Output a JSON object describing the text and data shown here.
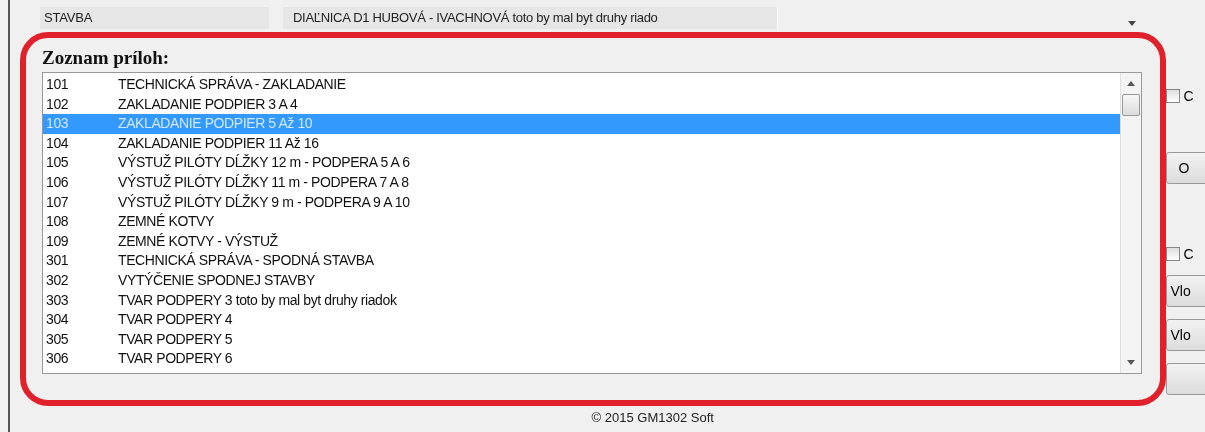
{
  "header": {
    "label": "STAVBA",
    "value": "DIAĽNICA D1 HUBOVÁ - IVACHNOVÁ toto by mal byt druhy riado"
  },
  "attachments": {
    "title": "Zoznam príloh:",
    "rows": [
      {
        "number": "101",
        "name": "TECHNICKÁ SPRÁVA - ZAKLADANIE",
        "selected": false
      },
      {
        "number": "102",
        "name": "ZAKLADANIE PODPIER 3 A 4",
        "selected": false
      },
      {
        "number": "103",
        "name": "ZAKLADANIE PODPIER 5 Až 10",
        "selected": true
      },
      {
        "number": "104",
        "name": "ZAKLADANIE PODPIER 11 Až 16",
        "selected": false
      },
      {
        "number": "105",
        "name": "VÝSTUŽ PILÓTY DĹŽKY 12 m - PODPERA 5 A 6",
        "selected": false
      },
      {
        "number": "106",
        "name": "VÝSTUŽ PILÓTY DĹŽKY 11 m - PODPERA 7 A 8",
        "selected": false
      },
      {
        "number": "107",
        "name": "VÝSTUŽ PILÓTY DĹŽKY 9 m - PODPERA 9 A 10",
        "selected": false
      },
      {
        "number": "108",
        "name": "ZEMNÉ KOTVY",
        "selected": false
      },
      {
        "number": "109",
        "name": "ZEMNÉ KOTVY - VÝSTUŽ",
        "selected": false
      },
      {
        "number": "301",
        "name": "TECHNICKÁ SPRÁVA - SPODNÁ STAVBA",
        "selected": false
      },
      {
        "number": "302",
        "name": "VYTÝČENIE SPODNEJ STAVBY",
        "selected": false
      },
      {
        "number": "303",
        "name": "TVAR PODPERY 3 toto by mal byt druhy riadok",
        "selected": false
      },
      {
        "number": "304",
        "name": "TVAR PODPERY 4",
        "selected": false
      },
      {
        "number": "305",
        "name": "TVAR PODPERY 5",
        "selected": false
      },
      {
        "number": "306",
        "name": "TVAR PODPERY 6",
        "selected": false
      }
    ]
  },
  "side_controls": [
    {
      "kind": "checkbox",
      "label": "C",
      "checked": false
    },
    {
      "kind": "button",
      "label": "O"
    },
    {
      "kind": "checkbox",
      "label": "C",
      "checked": false
    },
    {
      "kind": "button",
      "label": "Vlo"
    },
    {
      "kind": "button",
      "label": "Vlo"
    },
    {
      "kind": "button"
    }
  ],
  "footer": "© 2015 GM1302 Soft"
}
